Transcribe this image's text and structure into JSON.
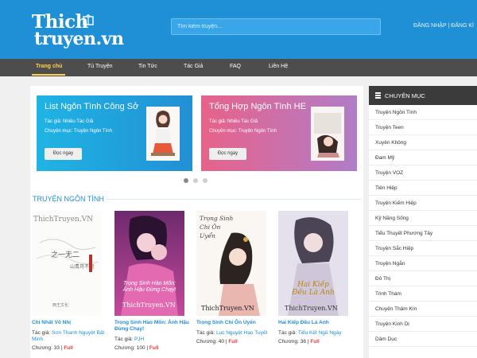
{
  "header": {
    "logo_top": "Thich",
    "logo_bottom": "truyen.vn",
    "search_placeholder": "Tìm kiếm truyện...",
    "auth": "ĐĂNG NHẬP | ĐĂNG KÍ"
  },
  "nav": {
    "items": [
      "Trang chủ",
      "Tủ Truyện",
      "Tin Tức",
      "Tác Giả",
      "FAQ",
      "Liên Hệ"
    ]
  },
  "slider": {
    "slides": [
      {
        "title": "List Ngôn Tình Công Sở",
        "author": "Tác giả: Nhiều Tác Giả",
        "category": "Chuyên mục: Truyện Ngôn Tình",
        "button": "Đọc ngay"
      },
      {
        "title": "Tổng Hợp Ngôn Tình HE",
        "author": "Tác giả: Nhiều Tác Giả",
        "category": "Chuyên mục: Truyện Ngôn Tình",
        "button": "Đọc ngay"
      }
    ]
  },
  "section": {
    "title": "TRUYỆN NGÔN TÌNH"
  },
  "books": [
    {
      "cover_watermark": "ThichTruyen.VN",
      "cover_text": "",
      "title": "Chi Nhất Vô Nhị",
      "author_label": "Tác giả:",
      "author": "Sơn Thanh Nguyệt Bất Minh",
      "chapters": "Chương: 33 |",
      "status": "Full"
    },
    {
      "cover_watermark": "ThichTruyen.VN",
      "cover_text": "Trọng Sinh Hào Môn: Ảnh Hậu Đừng Chạy!",
      "title": "Trọng Sinh Hào Môn: Ảnh Hậu Đừng Chạy!",
      "author_label": "Tác giả:",
      "author": "PJH",
      "chapters": "Chương: 100 |",
      "status": "Full"
    },
    {
      "cover_watermark": "ThichTruyen.VN",
      "cover_text": "Trọng Sinh Chi Ôn Uyển",
      "title": "Trọng Sinh Chi Ôn Uyển",
      "author_label": "Tác giả:",
      "author": "Lục Nguyệt Hạo Tuyết",
      "chapters": "Chương: 40 |",
      "status": "Full"
    },
    {
      "cover_watermark": "ThichTruyen.VN",
      "cover_text": "Hai Kiếp Đều Là Anh",
      "title": "Hai Kiếp Đều Là Anh",
      "author_label": "Tác giả:",
      "author": "Tiểu Kết Ngủ Ngày",
      "chapters": "Chương: 36 |",
      "status": "Full"
    }
  ],
  "sidebar": {
    "title": "CHUYÊN MỤC",
    "items": [
      "Truyện Ngôn Tình",
      "Truyện Teen",
      "Xuyên Không",
      "Đam Mỹ",
      "Truyện VOZ",
      "Tiên Hiệp",
      "Truyện Kiếm Hiệp",
      "Kỹ Năng Sống",
      "Tiểu Thuyết Phương Tây",
      "Truyện Sắc Hiệp",
      "Truyện Ngắn",
      "Đô Thị",
      "Trinh Thám",
      "Chuyện Thâm Kín",
      "Truyện Kinh Dị",
      "Dâm Dục"
    ]
  },
  "colors": {
    "header_bg": "#1f8fd6",
    "nav_bg": "#4d4d4d",
    "nav_active": "#ffd24a",
    "link": "#1f8fd6",
    "full_badge": "#e53935",
    "sidebar_head": "#3b3b3b"
  }
}
